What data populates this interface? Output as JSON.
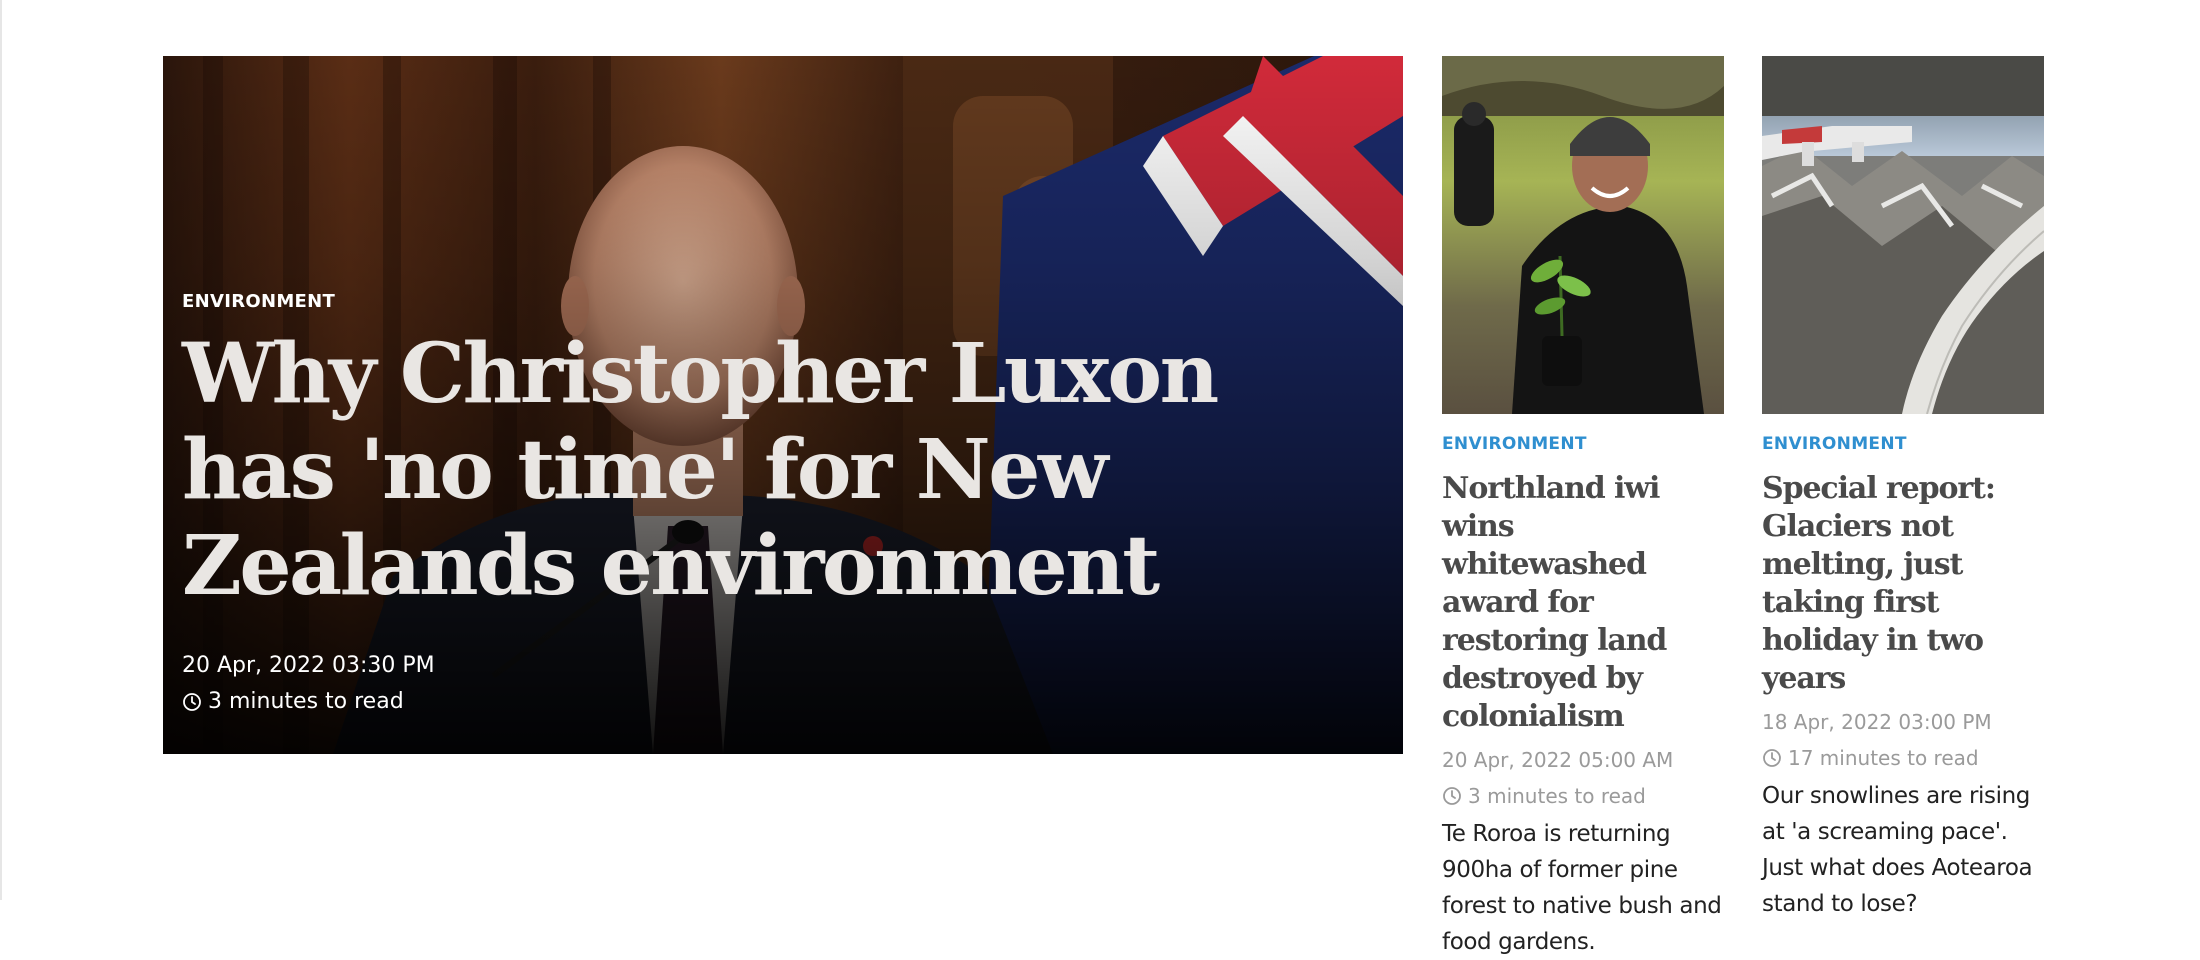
{
  "featured": {
    "category": "ENVIRONMENT",
    "title": "Why Christopher Luxon has 'no time' for New Zealands environment",
    "date": "20 Apr, 2022 03:30 PM",
    "read_time": "3 minutes to read",
    "image_icon": "photo-of-man-at-podium-with-flag"
  },
  "stories": [
    {
      "category": "ENVIRONMENT",
      "title": "Northland iwi wins whitewashed award for restoring land destroyed by colonialism",
      "date": "20 Apr, 2022 05:00 AM",
      "read_time": "3 minutes to read",
      "summary": "Te Roroa is returning 900ha of former pine forest to native bush and food gardens.",
      "image_icon": "photo-of-woman-holding-seedling"
    },
    {
      "category": "ENVIRONMENT",
      "title": "Special report: Glaciers not melting, just taking first holiday in two years",
      "date": "18 Apr, 2022 03:00 PM",
      "read_time": "17 minutes to read",
      "summary": "Our snowlines are rising at 'a screaming pace'. Just what does Aotearoa stand to lose?",
      "image_icon": "photo-of-glacier-from-plane"
    }
  ],
  "colors": {
    "category_blue": "#2f8fd0",
    "headline_gray": "#4a4a4a",
    "meta_gray": "#9a9a9a",
    "body_text": "#222222"
  }
}
